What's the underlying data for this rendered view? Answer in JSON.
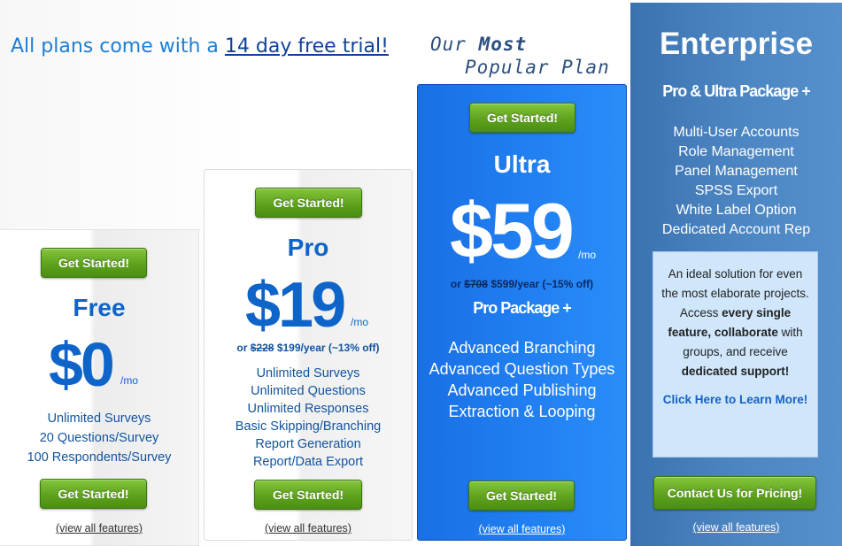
{
  "trial": {
    "prefix": "All plans come with a ",
    "link": "14 day free trial!"
  },
  "popular": {
    "word1": "Our",
    "word2": "Most",
    "line2": "Popular Plan"
  },
  "free": {
    "cta_top": "Get Started!",
    "name": "Free",
    "price": "$0",
    "per": "/mo",
    "features": [
      "Unlimited Surveys",
      "20 Questions/Survey",
      "100 Respondents/Survey"
    ],
    "cta_bottom": "Get Started!",
    "view_all": "(view all features)"
  },
  "pro": {
    "cta_top": "Get Started!",
    "name": "Pro",
    "price": "$19",
    "per": "/mo",
    "yearly_prefix": "or",
    "yearly_old": "$228",
    "yearly_new": "$199",
    "yearly_suffix": "/year (~13% off)",
    "features": [
      "Unlimited Surveys",
      "Unlimited Questions",
      "Unlimited Responses",
      "Basic Skipping/Branching",
      "Report Generation",
      "Report/Data Export"
    ],
    "cta_bottom": "Get Started!",
    "view_all": "(view all features)"
  },
  "ultra": {
    "cta_top": "Get Started!",
    "name": "Ultra",
    "price": "$59",
    "per": "/mo",
    "yearly_prefix": "or",
    "yearly_old": "$708",
    "yearly_new": "$599",
    "yearly_suffix": "/year (~15% off)",
    "package": "Pro Package +",
    "features": [
      "Advanced Branching",
      "Advanced Question Types",
      "Advanced Publishing",
      "Extraction & Looping"
    ],
    "cta_bottom": "Get Started!",
    "view_all": "(view all features)"
  },
  "enterprise": {
    "name": "Enterprise",
    "package": "Pro & Ultra Package +",
    "features": [
      "Multi-User Accounts",
      "Role Management",
      "Panel Management",
      "SPSS Export",
      "White Label Option",
      "Dedicated Account Rep"
    ],
    "box": {
      "text1": "An ideal solution for even the most elaborate projects. Access ",
      "bold1": "every single feature,",
      "text2": " ",
      "bold2": "collaborate",
      "text3": " with groups, and receive ",
      "bold3": "dedicated support!",
      "link": "Click Here to Learn More!"
    },
    "cta": "Contact Us for Pricing!",
    "view_all": "(view all features)"
  }
}
